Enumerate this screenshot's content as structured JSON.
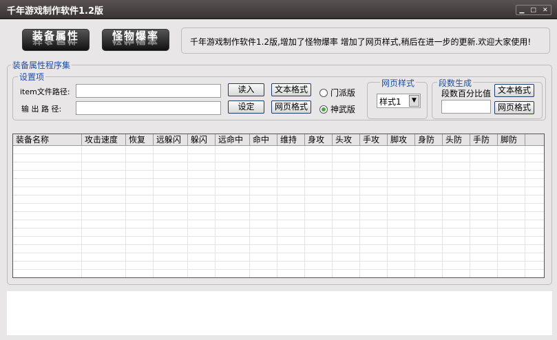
{
  "window": {
    "title": "千年游戏制作软件1.2版",
    "controls": [
      "minimize",
      "maximize",
      "close"
    ]
  },
  "top_buttons": [
    {
      "label": "装备属性"
    },
    {
      "label": "怪物爆率"
    }
  ],
  "notice": "千年游戏制作软件1.2版,增加了怪物爆率 增加了网页样式,稍后在进一步的更新.欢迎大家使用!",
  "main_group": {
    "title": "装备属性程序集",
    "settings": {
      "title": "设置项",
      "item_path_label": "item文件路径:",
      "item_path_value": "",
      "output_path_label": "输 出 路 径:",
      "output_path_value": "",
      "read_button": "读入",
      "set_button": "设定",
      "text_format_button": "文本格式",
      "web_format_button": "网页格式",
      "radio_options": [
        {
          "label": "门派版",
          "checked": false
        },
        {
          "label": "神武版",
          "checked": true
        }
      ]
    },
    "web_style": {
      "title": "网页样式",
      "selected": "样式1"
    },
    "segment": {
      "title": "段数生成",
      "percent_label": "段数百分比值",
      "percent_value": "",
      "text_format_button": "文本格式",
      "web_format_button": "网页格式"
    }
  },
  "table": {
    "columns": [
      "装备名称",
      "攻击速度",
      "恢复",
      "远躲闪",
      "躲闪",
      "远命中",
      "命中",
      "维持",
      "身攻",
      "头攻",
      "手攻",
      "脚攻",
      "身防",
      "头防",
      "手防",
      "脚防"
    ],
    "rows": []
  }
}
